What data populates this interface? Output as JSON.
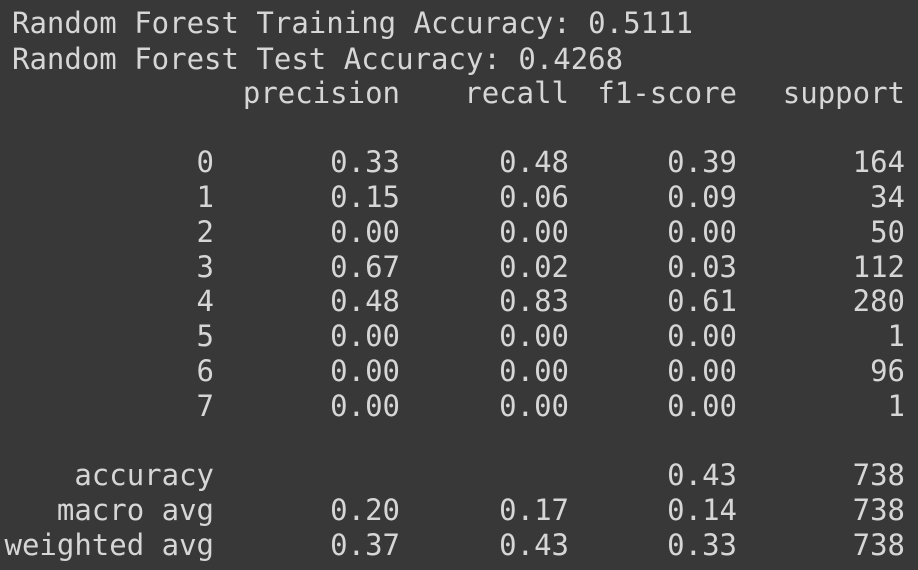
{
  "output": {
    "train_line": "Random Forest Training Accuracy: 0.5111",
    "test_line": "Random Forest Test Accuracy: 0.4268"
  },
  "report": {
    "headers": [
      "precision",
      "recall",
      "f1-score",
      "support"
    ],
    "rows": [
      {
        "label": "0",
        "precision": "0.33",
        "recall": "0.48",
        "f1": "0.39",
        "support": "164"
      },
      {
        "label": "1",
        "precision": "0.15",
        "recall": "0.06",
        "f1": "0.09",
        "support": "34"
      },
      {
        "label": "2",
        "precision": "0.00",
        "recall": "0.00",
        "f1": "0.00",
        "support": "50"
      },
      {
        "label": "3",
        "precision": "0.67",
        "recall": "0.02",
        "f1": "0.03",
        "support": "112"
      },
      {
        "label": "4",
        "precision": "0.48",
        "recall": "0.83",
        "f1": "0.61",
        "support": "280"
      },
      {
        "label": "5",
        "precision": "0.00",
        "recall": "0.00",
        "f1": "0.00",
        "support": "1"
      },
      {
        "label": "6",
        "precision": "0.00",
        "recall": "0.00",
        "f1": "0.00",
        "support": "96"
      },
      {
        "label": "7",
        "precision": "0.00",
        "recall": "0.00",
        "f1": "0.00",
        "support": "1"
      }
    ],
    "summary": [
      {
        "label": "accuracy",
        "precision": "",
        "recall": "",
        "f1": "0.43",
        "support": "738"
      },
      {
        "label": "macro avg",
        "precision": "0.20",
        "recall": "0.17",
        "f1": "0.14",
        "support": "738"
      },
      {
        "label": "weighted avg",
        "precision": "0.37",
        "recall": "0.43",
        "f1": "0.33",
        "support": "738"
      }
    ]
  }
}
